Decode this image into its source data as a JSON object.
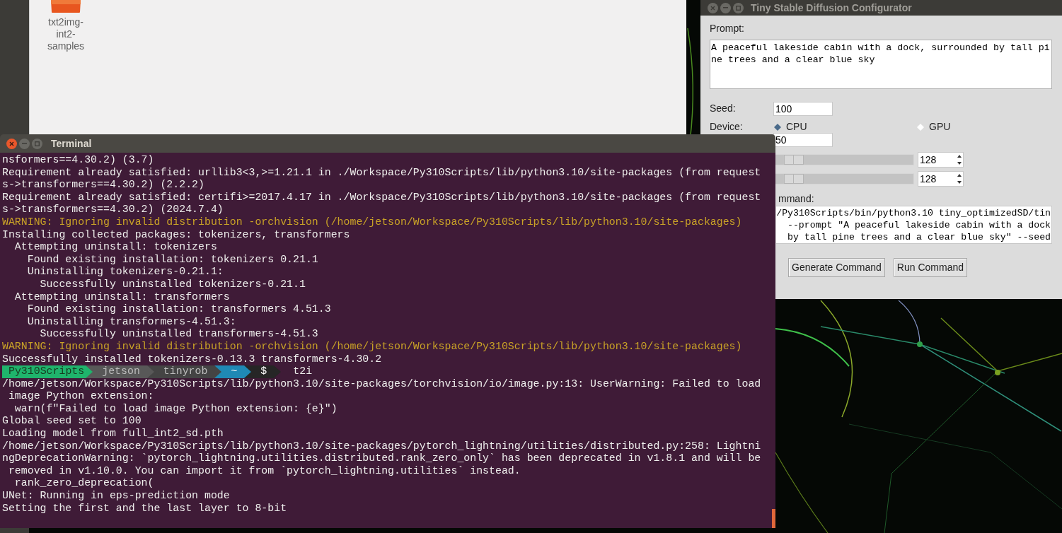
{
  "file_manager": {
    "items": [
      {
        "label": "txt2img-int2-samples"
      }
    ]
  },
  "configurator": {
    "title": "Tiny Stable Diffusion Configurator",
    "prompt_label": "Prompt:",
    "prompt_value": "A peaceful lakeside cabin with a dock, surrounded by tall pine trees and a clear blue sky",
    "seed_label": "Seed:",
    "seed_value": "100",
    "device_label": "Device:",
    "devices": [
      {
        "label": "CPU",
        "selected": true
      },
      {
        "label": "GPU",
        "selected": false
      }
    ],
    "steps_value": "50",
    "sliders": [
      {
        "level": 0.08,
        "value": "128"
      },
      {
        "level": 0.08,
        "value": "128"
      }
    ],
    "command_label": "mmand:",
    "command_lines": [
      "/Py310Scripts/bin/python3.10 tiny_optimizedSD/tin",
      "--prompt \"A peaceful lakeside cabin with a dock",
      "by tall pine trees and a clear blue sky\" --seed"
    ],
    "buttons": [
      "Generate Command",
      "Run Command"
    ]
  },
  "terminal": {
    "title": "Terminal",
    "lines": [
      {
        "kind": "text",
        "text": "nsformers==4.30.2) (3.7)"
      },
      {
        "kind": "text",
        "text": "Requirement already satisfied: urllib3<3,>=1.21.1 in ./Workspace/Py310Scripts/lib/python3.10/site-packages (from request"
      },
      {
        "kind": "text",
        "text": "s->transformers==4.30.2) (2.2.2)"
      },
      {
        "kind": "text",
        "text": "Requirement already satisfied: certifi>=2017.4.17 in ./Workspace/Py310Scripts/lib/python3.10/site-packages (from request"
      },
      {
        "kind": "text",
        "text": "s->transformers==4.30.2) (2024.7.4)"
      },
      {
        "kind": "warning",
        "text": "WARNING: Ignoring invalid distribution -orchvision (/home/jetson/Workspace/Py310Scripts/lib/python3.10/site-packages)"
      },
      {
        "kind": "text",
        "text": "Installing collected packages: tokenizers, transformers"
      },
      {
        "kind": "text",
        "text": "  Attempting uninstall: tokenizers"
      },
      {
        "kind": "text",
        "text": "    Found existing installation: tokenizers 0.21.1"
      },
      {
        "kind": "text",
        "text": "    Uninstalling tokenizers-0.21.1:"
      },
      {
        "kind": "text",
        "text": "      Successfully uninstalled tokenizers-0.21.1"
      },
      {
        "kind": "text",
        "text": "  Attempting uninstall: transformers"
      },
      {
        "kind": "text",
        "text": "    Found existing installation: transformers 4.51.3"
      },
      {
        "kind": "text",
        "text": "    Uninstalling transformers-4.51.3:"
      },
      {
        "kind": "text",
        "text": "      Successfully uninstalled transformers-4.51.3"
      },
      {
        "kind": "warning",
        "text": "WARNING: Ignoring invalid distribution -orchvision (/home/jetson/Workspace/Py310Scripts/lib/python3.10/site-packages)"
      },
      {
        "kind": "text",
        "text": "Successfully installed tokenizers-0.13.3 transformers-4.30.2"
      },
      {
        "kind": "prompt",
        "segments": [
          {
            "text": "Py310Scripts",
            "color": "#1fb46c"
          },
          {
            "text": "jetson",
            "color": "#585858"
          },
          {
            "text": "tinyrob",
            "color": "#444444"
          },
          {
            "text": "~",
            "color": "#1f89b5"
          },
          {
            "text": "$",
            "color": "#262626"
          }
        ],
        "command": "t2i"
      },
      {
        "kind": "text",
        "text": "/home/jetson/Workspace/Py310Scripts/lib/python3.10/site-packages/torchvision/io/image.py:13: UserWarning: Failed to load"
      },
      {
        "kind": "text",
        "text": " image Python extension:"
      },
      {
        "kind": "text",
        "text": "  warn(f\"Failed to load image Python extension: {e}\")"
      },
      {
        "kind": "text",
        "text": "Global seed set to 100"
      },
      {
        "kind": "text",
        "text": "Loading model from full_int2_sd.pth"
      },
      {
        "kind": "text",
        "text": "/home/jetson/Workspace/Py310Scripts/lib/python3.10/site-packages/pytorch_lightning/utilities/distributed.py:258: Lightni"
      },
      {
        "kind": "text",
        "text": "ngDeprecationWarning: `pytorch_lightning.utilities.distributed.rank_zero_only` has been deprecated in v1.8.1 and will be"
      },
      {
        "kind": "text",
        "text": " removed in v1.10.0. You can import it from `pytorch_lightning.utilities` instead."
      },
      {
        "kind": "text",
        "text": "  rank_zero_deprecation("
      },
      {
        "kind": "text",
        "text": "UNet: Running in eps-prediction mode"
      },
      {
        "kind": "text",
        "text": "Setting the first and the last layer to 8-bit"
      }
    ]
  }
}
